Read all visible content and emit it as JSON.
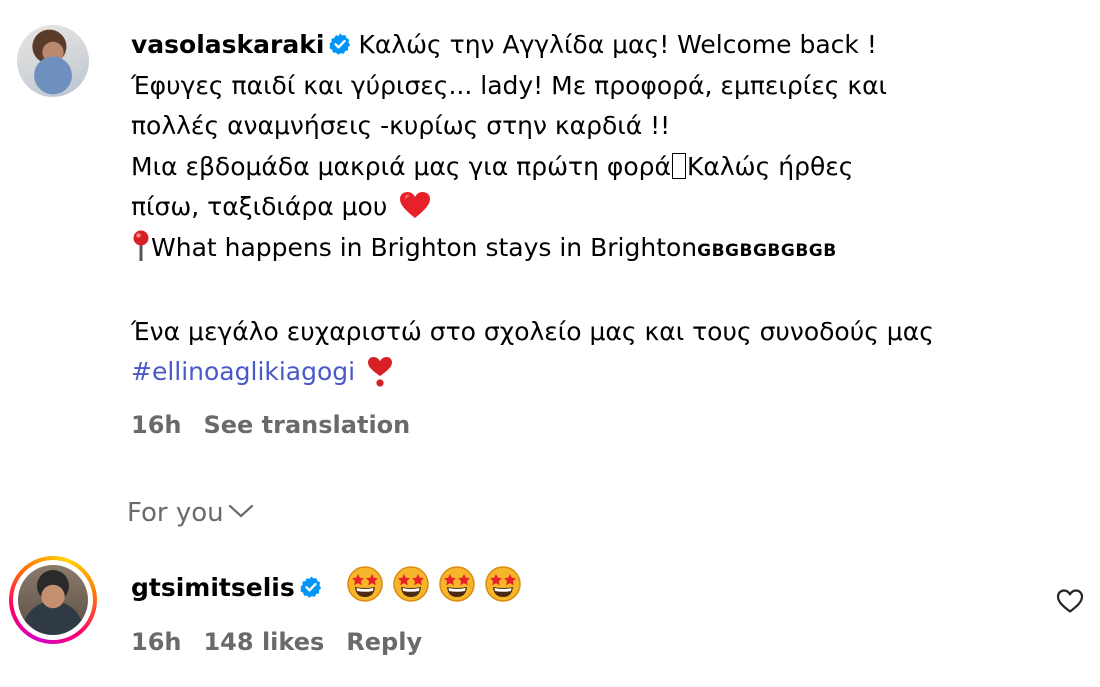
{
  "comment1": {
    "username": "vasolaskaraki",
    "lines": [
      "Καλώς την Αγγλίδα μας! Welcome back !",
      "Έφυγες παιδί και γύρισες... lady! Με προφορά, εμπειρίες και",
      "πολλές αναμνήσεις -κυρίως στην καρδιά !!",
      "Μια εβδομάδα μακριά μας για πρώτη φορά",
      "Καλώς ήρθες",
      "πίσω, ταξιδιάρα μου",
      "What happens in Brighton stays in Brighton",
      "GBGBGBGBGB",
      "Ένα μεγάλο ευχαριστώ στο σχολείο μας και τους συνοδούς μας",
      "#ellinoaglikiagogi"
    ],
    "time": "16h",
    "see_translation": "See translation"
  },
  "section_label": "For you",
  "comment2": {
    "username": "gtsimitselis",
    "time": "16h",
    "likes": "148 likes",
    "reply": "Reply"
  },
  "icons": {
    "verified": "verified-badge-icon",
    "heart": "red-heart-emoji",
    "pushpin": "round-pushpin-emoji",
    "exclamation_heart": "heart-exclamation-emoji",
    "star_eyes": "star-struck-emoji",
    "like": "heart-outline-icon",
    "chevron": "chevron-down-icon"
  },
  "colors": {
    "verified_blue": "#0095f6",
    "hashtag": "#4a58c8",
    "meta_gray": "#6a6a6a"
  }
}
